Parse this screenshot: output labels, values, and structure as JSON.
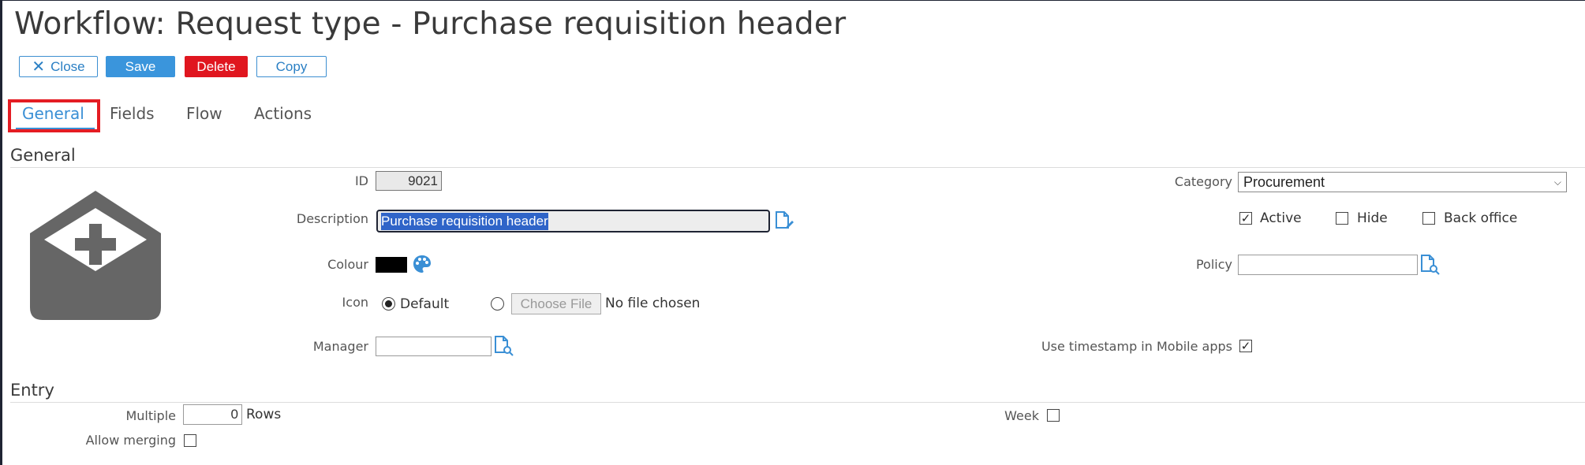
{
  "page_title": "Workflow: Request type - Purchase requisition header",
  "toolbar": {
    "close_label": "Close",
    "save_label": "Save",
    "delete_label": "Delete",
    "copy_label": "Copy"
  },
  "tabs": [
    {
      "label": "General",
      "active": true
    },
    {
      "label": "Fields",
      "active": false
    },
    {
      "label": "Flow",
      "active": false
    },
    {
      "label": "Actions",
      "active": false
    }
  ],
  "general": {
    "section_title": "General",
    "large_icon": "envelope-plus-icon",
    "id_label": "ID",
    "id_value": "9021",
    "description_label": "Description",
    "description_value": "Purchase requisition header",
    "colour_label": "Colour",
    "colour_value": "#000000",
    "icon_label": "Icon",
    "icon_default_label": "Default",
    "icon_option_selected": "Default",
    "choose_file_label": "Choose File",
    "no_file_text": "No file chosen",
    "manager_label": "Manager",
    "manager_value": "",
    "category_label": "Category",
    "category_value": "Procurement",
    "active_label": "Active",
    "active_checked": true,
    "hide_label": "Hide",
    "hide_checked": false,
    "back_office_label": "Back office",
    "back_office_checked": false,
    "policy_label": "Policy",
    "policy_value": "",
    "timestamp_label": "Use timestamp in Mobile apps",
    "timestamp_checked": true
  },
  "entry": {
    "section_title": "Entry",
    "multiple_label": "Multiple",
    "multiple_value": "0",
    "rows_label": "Rows",
    "allow_merging_label": "Allow merging",
    "allow_merging_checked": false,
    "week_label": "Week",
    "week_checked": false
  },
  "colors": {
    "accent": "#3a95dc",
    "danger": "#e0161f",
    "highlight": "#e41c23",
    "selection": "#2f64c8"
  }
}
